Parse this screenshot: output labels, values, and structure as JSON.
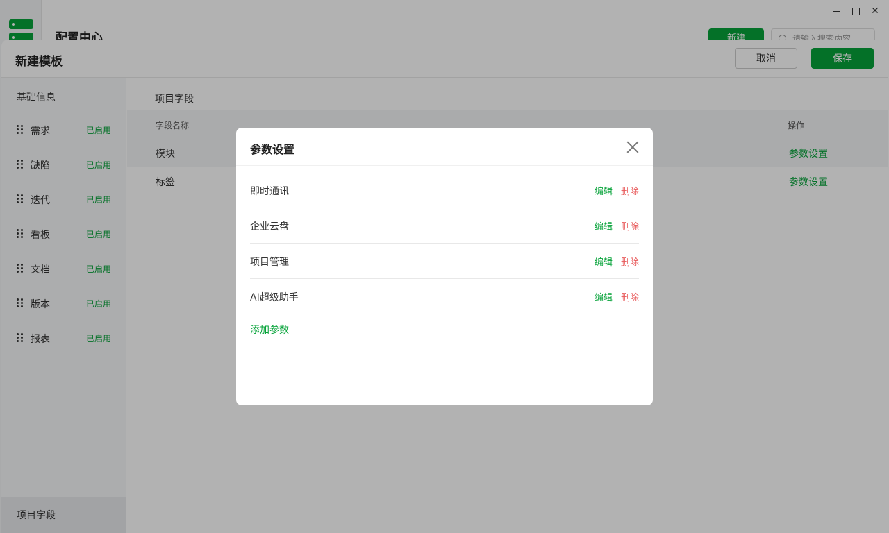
{
  "app": {
    "title": "配置中心",
    "new_button": "新建",
    "search_placeholder": "请输入搜索内容"
  },
  "colors": {
    "accent": "#07a33a",
    "danger": "#e8595a"
  },
  "drawer": {
    "title": "新建模板",
    "cancel_label": "取消",
    "save_label": "保存"
  },
  "left_nav": {
    "basic_info": "基础信息",
    "items": [
      {
        "label": "需求",
        "status": "已启用"
      },
      {
        "label": "缺陷",
        "status": "已启用"
      },
      {
        "label": "迭代",
        "status": "已启用"
      },
      {
        "label": "看板",
        "status": "已启用"
      },
      {
        "label": "文档",
        "status": "已启用"
      },
      {
        "label": "版本",
        "status": "已启用"
      },
      {
        "label": "报表",
        "status": "已启用"
      }
    ],
    "bottom": "项目字段"
  },
  "main": {
    "section_title": "项目字段",
    "columns": {
      "name": "字段名称",
      "action": "操作"
    },
    "rows": [
      {
        "name": "模块",
        "action": "参数设置"
      },
      {
        "name": "标签",
        "action": "参数设置"
      }
    ]
  },
  "modal": {
    "title": "参数设置",
    "params": [
      {
        "name": "即时通讯",
        "edit": "编辑",
        "delete": "删除"
      },
      {
        "name": "企业云盘",
        "edit": "编辑",
        "delete": "删除"
      },
      {
        "name": "项目管理",
        "edit": "编辑",
        "delete": "删除"
      },
      {
        "name": "AI超级助手",
        "edit": "编辑",
        "delete": "删除"
      }
    ],
    "add_label": "添加参数"
  }
}
